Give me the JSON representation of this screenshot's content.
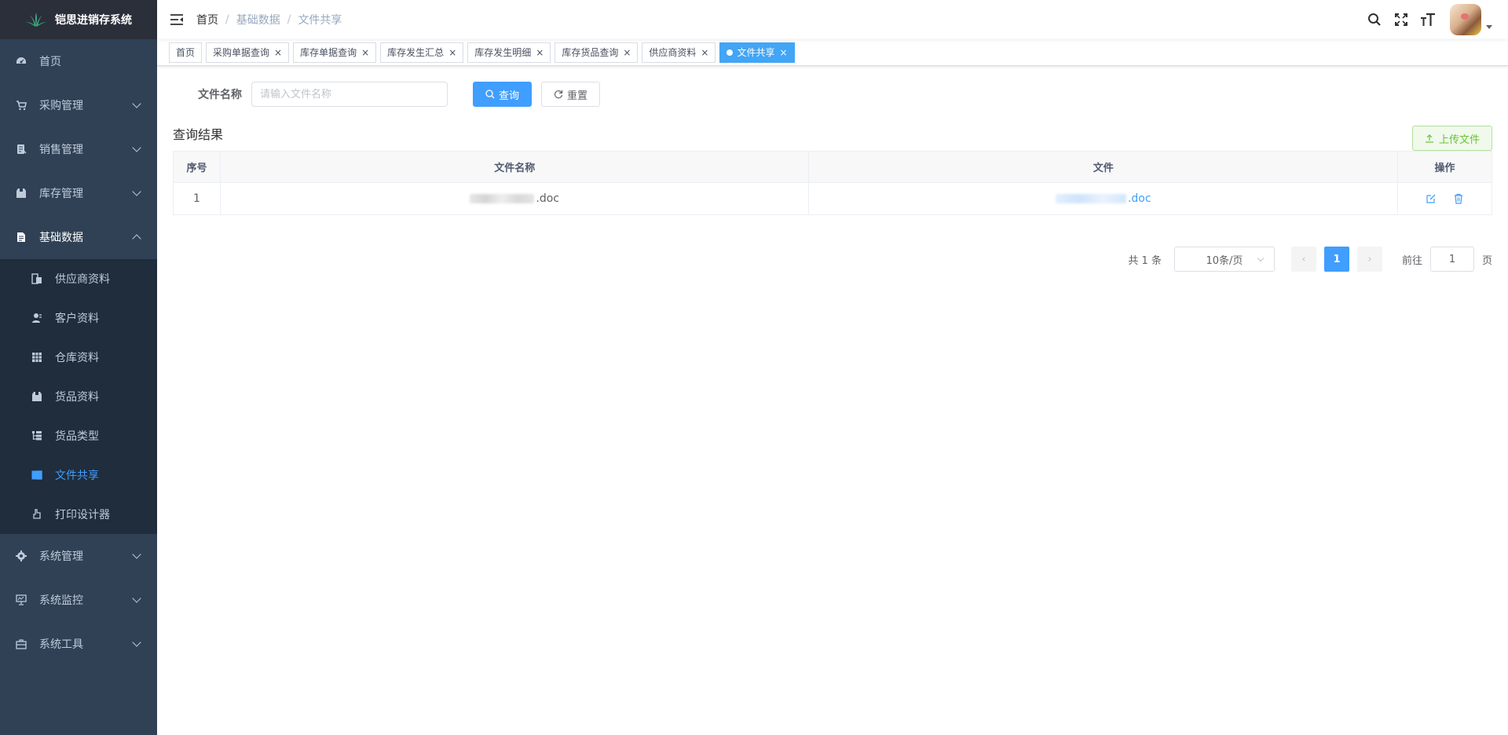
{
  "app": {
    "logo_text": "铠思进销存系统"
  },
  "sidebar": {
    "items": [
      {
        "label": "首页",
        "icon": "dashboard-icon"
      },
      {
        "label": "采购管理",
        "icon": "cart-icon"
      },
      {
        "label": "销售管理",
        "icon": "sales-icon"
      },
      {
        "label": "库存管理",
        "icon": "inventory-icon"
      },
      {
        "label": "基础数据",
        "icon": "document-icon"
      }
    ],
    "sub_items": [
      {
        "label": "供应商资料",
        "icon": "supplier-icon"
      },
      {
        "label": "客户资料",
        "icon": "customer-icon"
      },
      {
        "label": "仓库资料",
        "icon": "warehouse-icon"
      },
      {
        "label": "货品资料",
        "icon": "goods-icon"
      },
      {
        "label": "货品类型",
        "icon": "tree-icon"
      },
      {
        "label": "文件共享",
        "icon": "file-share-icon"
      },
      {
        "label": "打印设计器",
        "icon": "print-icon"
      }
    ],
    "bottom_items": [
      {
        "label": "系统管理",
        "icon": "settings-icon"
      },
      {
        "label": "系统监控",
        "icon": "monitor-icon"
      },
      {
        "label": "系统工具",
        "icon": "toolbox-icon"
      }
    ],
    "colors": {
      "background": "#304156",
      "submenu": "#1f2d3d",
      "active": "#409eff"
    }
  },
  "breadcrumb": [
    "首页",
    "基础数据",
    "文件共享"
  ],
  "tags": [
    {
      "label": "首页",
      "closable": false
    },
    {
      "label": "采购单据查询",
      "closable": true
    },
    {
      "label": "库存单据查询",
      "closable": true
    },
    {
      "label": "库存发生汇总",
      "closable": true
    },
    {
      "label": "库存发生明细",
      "closable": true
    },
    {
      "label": "库存货品查询",
      "closable": true
    },
    {
      "label": "供应商资料",
      "closable": true
    },
    {
      "label": "文件共享",
      "closable": true,
      "active": true
    }
  ],
  "search": {
    "label": "文件名称",
    "placeholder": "请输入文件名称",
    "query_label": "查询",
    "reset_label": "重置"
  },
  "results": {
    "title": "查询结果",
    "upload_label": "上传文件"
  },
  "table": {
    "headers": [
      "序号",
      "文件名称",
      "文件",
      "操作"
    ],
    "rows": [
      {
        "index": "1",
        "name_suffix": ".doc",
        "file_suffix": ".doc"
      }
    ]
  },
  "pagination": {
    "total": "共 1 条",
    "page_size": "10条/页",
    "current": "1",
    "goto_prefix": "前往",
    "goto_value": "1",
    "goto_suffix": "页"
  }
}
